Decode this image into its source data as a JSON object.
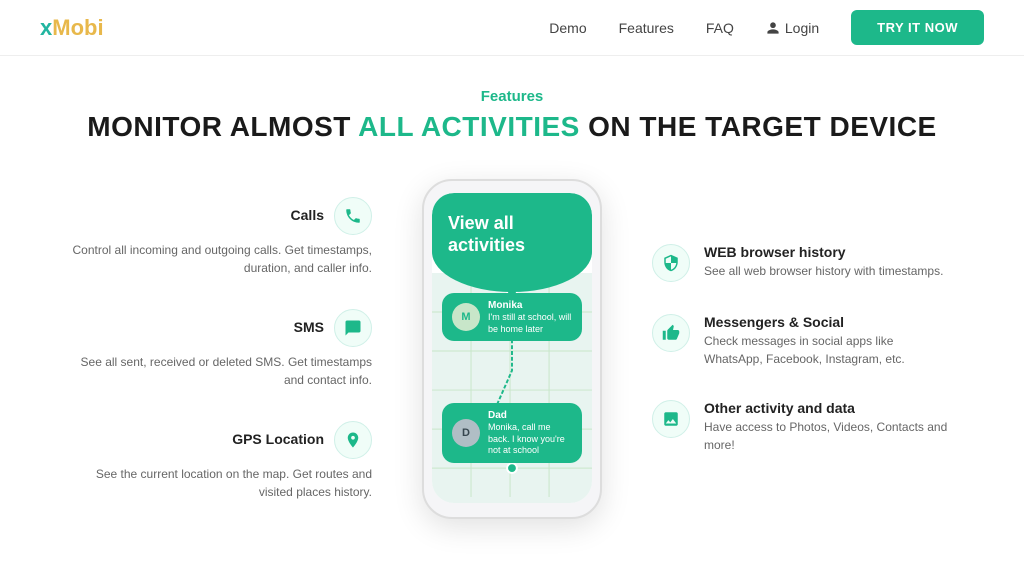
{
  "header": {
    "logo_x": "x",
    "logo_mobi": "Mobi",
    "nav": [
      {
        "label": "Demo",
        "id": "nav-demo"
      },
      {
        "label": "Features",
        "id": "nav-features"
      },
      {
        "label": "FAQ",
        "id": "nav-faq"
      }
    ],
    "login_label": "Login",
    "try_btn": "TRY IT NOW"
  },
  "hero": {
    "section_label": "Features",
    "title_part1": "MONITOR ALMOST ",
    "title_highlight": "ALL ACTIVITIES",
    "title_part2": " ON THE TARGET DEVICE"
  },
  "features_left": [
    {
      "id": "calls",
      "title": "Calls",
      "desc": "Control all incoming and outgoing calls. Get timestamps, duration, and caller info.",
      "icon": "phone"
    },
    {
      "id": "sms",
      "title": "SMS",
      "desc": "See all sent, received or deleted SMS. Get timestamps and contact info.",
      "icon": "chat"
    },
    {
      "id": "gps",
      "title": "GPS Location",
      "desc": "See the current location on the map. Get routes and visited places history.",
      "icon": "pin"
    }
  ],
  "phone": {
    "header_text": "View all activities",
    "contact1_name": "Monika",
    "contact1_msg": "I'm still at school, will be home later",
    "contact2_name": "Dad",
    "contact2_msg": "Monika, call me back. I know you're not at school"
  },
  "features_right": [
    {
      "id": "web",
      "title": "WEB browser history",
      "desc": "See all web browser history with timestamps.",
      "icon": "shield"
    },
    {
      "id": "messengers",
      "title": "Messengers & Social",
      "desc": "Check messages in social apps like WhatsApp, Facebook, Instagram, etc.",
      "icon": "thumb"
    },
    {
      "id": "other",
      "title": "Other activity and data",
      "desc": "Have access to Photos, Videos, Contacts and more!",
      "icon": "image"
    }
  ],
  "colors": {
    "green": "#1db88a",
    "yellow": "#e8b84b",
    "text_dark": "#1a1a1a",
    "text_mid": "#444",
    "text_light": "#666"
  }
}
